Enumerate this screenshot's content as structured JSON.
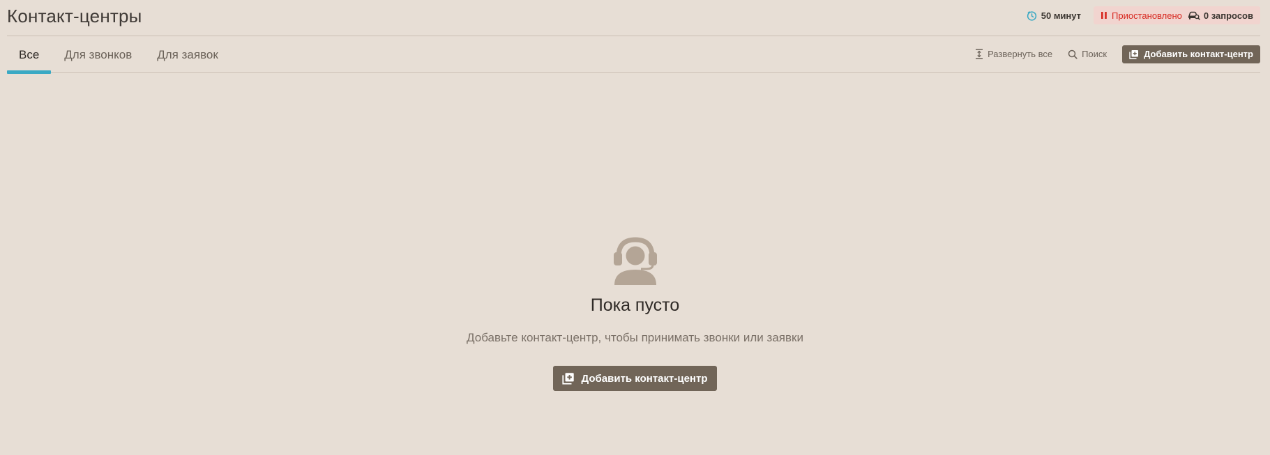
{
  "header": {
    "title": "Контакт-центры",
    "timer": "50 минут",
    "status": "Приостановлено",
    "requests": "0 запросов"
  },
  "tabs": [
    {
      "label": "Все",
      "active": true
    },
    {
      "label": "Для звонков",
      "active": false
    },
    {
      "label": "Для заявок",
      "active": false
    }
  ],
  "toolbar": {
    "expand_label": "Развернуть все",
    "search_label": "Поиск",
    "add_label": "Добавить контакт-центр"
  },
  "empty_state": {
    "title": "Пока пусто",
    "description": "Добавьте контакт-центр, чтобы принимать звонки или заявки",
    "button_label": "Добавить контакт-центр"
  },
  "colors": {
    "background": "#e7ded5",
    "accent": "#3aa9c4",
    "button": "#716558",
    "status_red": "#d7271f",
    "status_bg": "#f1d4cf",
    "illustration": "#b4a596"
  },
  "icons": {
    "timer": "clock-icon",
    "status": "pause-icon",
    "requests": "car-search-icon",
    "expand": "expand-vertical-icon",
    "search": "search-icon",
    "add": "add-square-icon",
    "empty": "operator-headset-icon"
  }
}
